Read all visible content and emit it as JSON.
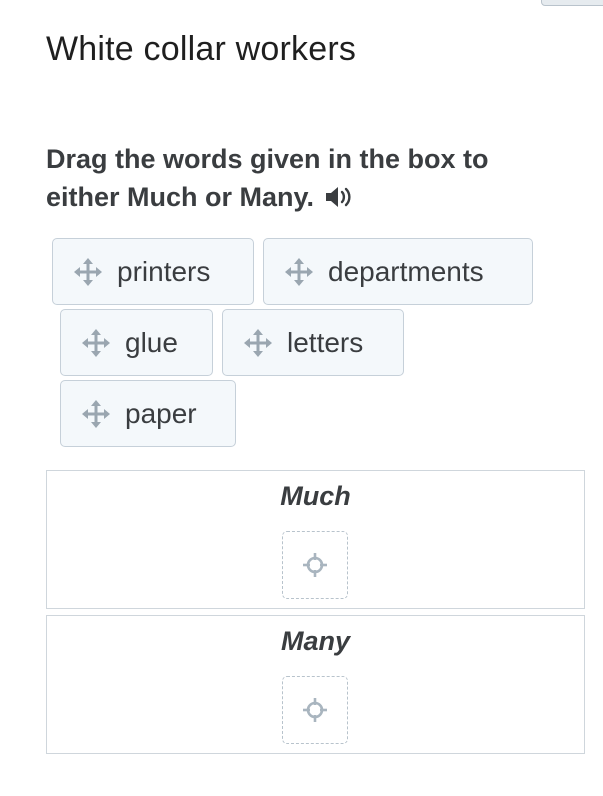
{
  "page": {
    "title": "White collar workers",
    "instructions": "Drag the words given in the box to either Much or Many."
  },
  "icons": {
    "audio": "speaker-icon",
    "draggable": "move-arrows-icon",
    "drop_target": "crosshair-icon"
  },
  "word_bank": [
    {
      "label": "printers"
    },
    {
      "label": "departments"
    },
    {
      "label": "glue"
    },
    {
      "label": "letters"
    },
    {
      "label": "paper"
    }
  ],
  "categories": [
    {
      "label": "Much"
    },
    {
      "label": "Many"
    }
  ],
  "colors": {
    "chip_background": "#f4f8fb",
    "chip_border": "#c6d0d9",
    "icon": "#9aa6b0",
    "text": "#3a3d40"
  }
}
